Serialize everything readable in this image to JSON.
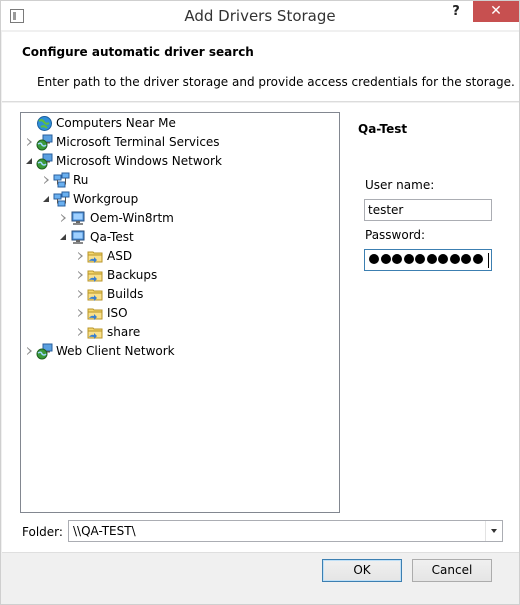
{
  "window": {
    "title": "Add Drivers Storage",
    "help_label": "?",
    "close_label": "✕"
  },
  "header": {
    "title": "Configure automatic driver search",
    "description": "Enter path to the driver storage and provide access credentials for the storage."
  },
  "tree": {
    "items": [
      {
        "label": "Computers Near Me",
        "icon": "globe-network-icon",
        "state": "none",
        "level": 0
      },
      {
        "label": "Microsoft Terminal Services",
        "icon": "network-globe-icon",
        "state": "collapsed",
        "level": 0
      },
      {
        "label": "Microsoft Windows Network",
        "icon": "network-globe-icon",
        "state": "expanded",
        "level": 0
      },
      {
        "label": "Ru",
        "icon": "domain-icon",
        "state": "collapsed",
        "level": 1
      },
      {
        "label": "Workgroup",
        "icon": "domain-icon",
        "state": "expanded",
        "level": 1
      },
      {
        "label": "Oem-Win8rtm",
        "icon": "computer-icon",
        "state": "collapsed",
        "level": 2
      },
      {
        "label": "Qa-Test",
        "icon": "computer-icon",
        "state": "expanded",
        "level": 2
      },
      {
        "label": "ASD",
        "icon": "shared-folder-icon",
        "state": "collapsed",
        "level": 3
      },
      {
        "label": "Backups",
        "icon": "shared-folder-icon",
        "state": "collapsed",
        "level": 3
      },
      {
        "label": "Builds",
        "icon": "shared-folder-icon",
        "state": "collapsed",
        "level": 3
      },
      {
        "label": "ISO",
        "icon": "shared-folder-icon",
        "state": "collapsed",
        "level": 3
      },
      {
        "label": "share",
        "icon": "shared-folder-icon",
        "state": "collapsed",
        "level": 3
      },
      {
        "label": "Web Client Network",
        "icon": "network-globe-icon",
        "state": "collapsed",
        "level": 0
      }
    ]
  },
  "credentials": {
    "selected_name": "Qa-Test",
    "username_label": "User name:",
    "username_value": "tester",
    "password_label": "Password:",
    "password_masked_count": 10
  },
  "folder": {
    "label": "Folder:",
    "value": "\\\\QA-TEST\\"
  },
  "buttons": {
    "ok_label": "OK",
    "cancel_label": "Cancel"
  }
}
